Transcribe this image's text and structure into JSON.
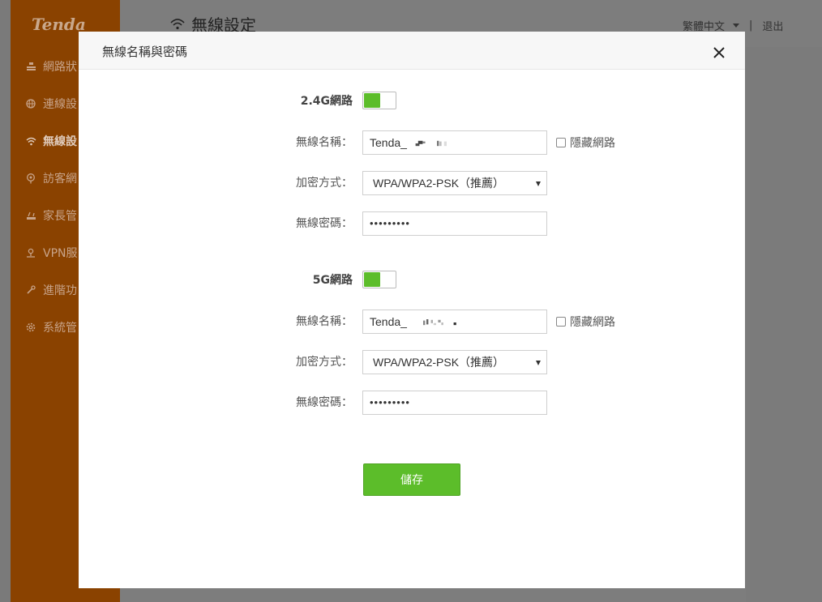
{
  "app": {
    "logo": "Tenda",
    "page_title": "無線設定",
    "language": "繁體中文",
    "separator": "|",
    "logout": "退出"
  },
  "sidebar": {
    "items": [
      {
        "label": "網路狀",
        "icon": "network-icon"
      },
      {
        "label": "連線設",
        "icon": "globe-icon"
      },
      {
        "label": "無線設",
        "icon": "wifi-icon",
        "active": true
      },
      {
        "label": "訪客網",
        "icon": "guest-icon"
      },
      {
        "label": "家長管",
        "icon": "parental-icon"
      },
      {
        "label": "VPN服",
        "icon": "vpn-icon"
      },
      {
        "label": "進階功",
        "icon": "wrench-icon"
      },
      {
        "label": "系統管",
        "icon": "gear-icon"
      }
    ]
  },
  "modal": {
    "title": "無線名稱與密碼",
    "close_icon": "close-icon",
    "band_24": {
      "label": "2.4G網路",
      "enabled": true,
      "ssid_label": "無線名稱：",
      "ssid_value": "Tenda_",
      "hide_label": "隱藏網路",
      "hidden": false,
      "security_label": "加密方式：",
      "security_value": "WPA/WPA2-PSK（推薦）",
      "password_label": "無線密碼：",
      "password_value": "•••••••••"
    },
    "band_5": {
      "label": "5G網路",
      "enabled": true,
      "ssid_label": "無線名稱：",
      "ssid_value": "Tenda_",
      "hide_label": "隱藏網路",
      "hidden": false,
      "security_label": "加密方式：",
      "security_value": "WPA/WPA2-PSK（推薦）",
      "password_label": "無線密碼：",
      "password_value": "•••••••••"
    },
    "save_label": "儲存"
  },
  "colors": {
    "accent_green": "#5cbd2a",
    "sidebar_brand": "#8a4200"
  }
}
